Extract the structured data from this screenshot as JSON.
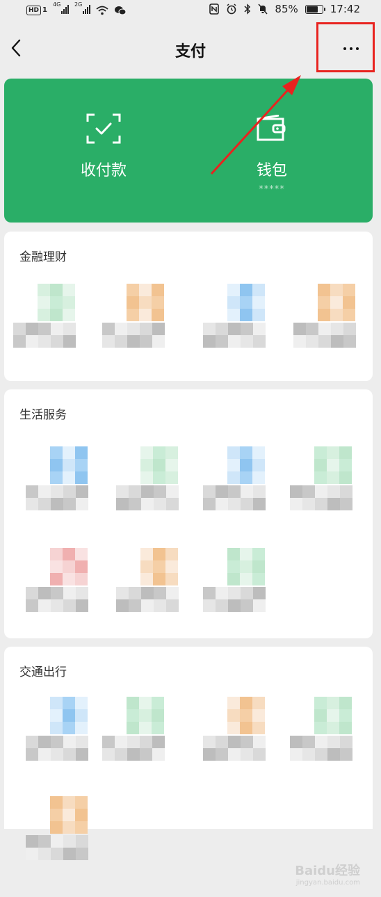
{
  "status_bar": {
    "hd": "HD",
    "sim": "1",
    "net1": "4G",
    "net2": "2G",
    "battery_text": "85%",
    "battery_level": 0.85,
    "time": "17:42"
  },
  "nav": {
    "title": "支付",
    "back_icon": "chevron-left-icon",
    "more_icon": "more-horizontal-icon",
    "highlight_color": "#e8231f"
  },
  "banner": {
    "color": "#2aae67",
    "items": [
      {
        "label": "收付款",
        "icon": "scan-check-icon"
      },
      {
        "label": "钱包",
        "icon": "wallet-icon",
        "sub": "*****"
      }
    ]
  },
  "sections": [
    {
      "title": "金融理财"
    },
    {
      "title": "生活服务"
    },
    {
      "title": "交通出行"
    }
  ],
  "watermark": {
    "brand": "Baidu经验",
    "url": "jingyan.baidu.com"
  }
}
